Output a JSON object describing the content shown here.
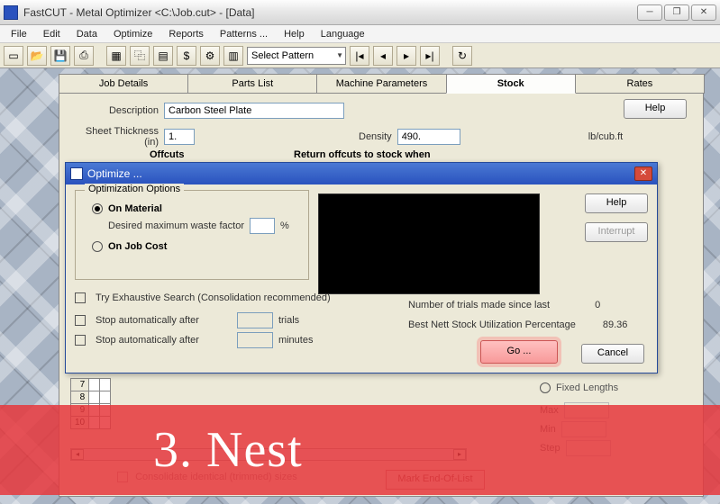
{
  "window": {
    "title": "FastCUT - Metal Optimizer <C:\\Job.cut> - [Data]"
  },
  "menu": {
    "file": "File",
    "edit": "Edit",
    "data": "Data",
    "optimize": "Optimize",
    "reports": "Reports",
    "patterns": "Patterns ...",
    "help": "Help",
    "language": "Language"
  },
  "toolbar": {
    "select_pattern": "Select Pattern"
  },
  "tabs": {
    "job_details": "Job Details",
    "parts_list": "Parts List",
    "machine_params": "Machine Parameters",
    "stock": "Stock",
    "rates": "Rates"
  },
  "stock_panel": {
    "description_label": "Description",
    "description_value": "Carbon Steel Plate",
    "thickness_label": "Sheet Thickness (in)",
    "thickness_value": "1.",
    "density_label": "Density",
    "density_value": "490.",
    "density_unit": "lb/cub.ft",
    "help": "Help",
    "offcuts": "Offcuts",
    "return_when": "Return offcuts to stock when"
  },
  "dialog": {
    "title": "Optimize ...",
    "group": "Optimization Options",
    "on_material": "On Material",
    "desired_waste": "Desired maximum waste factor",
    "waste_unit": "%",
    "on_job_cost": "On Job Cost",
    "try_exhaustive": "Try Exhaustive Search (Consolidation  recommended)",
    "stop_after": "Stop automatically after",
    "trials": "trials",
    "minutes": "minutes",
    "trials_label": "Number of trials made since last",
    "trials_value": "0",
    "util_label": "Best Nett Stock Utilization Percentage",
    "util_value": "89.36",
    "help": "Help",
    "interrupt": "Interrupt",
    "go": "Go ...",
    "cancel": "Cancel"
  },
  "grid": {
    "r7": "7",
    "r8": "8",
    "r9": "9",
    "r10": "10"
  },
  "right": {
    "fixed_lengths": "Fixed Lengths",
    "max": "Max",
    "min": "Min",
    "step": "Step"
  },
  "bottom": {
    "consolidate": "Consolidate identical (trimmed) sizes",
    "mark_eol": "Mark End-Of-List"
  },
  "overlay": {
    "text": "3. Nest"
  }
}
